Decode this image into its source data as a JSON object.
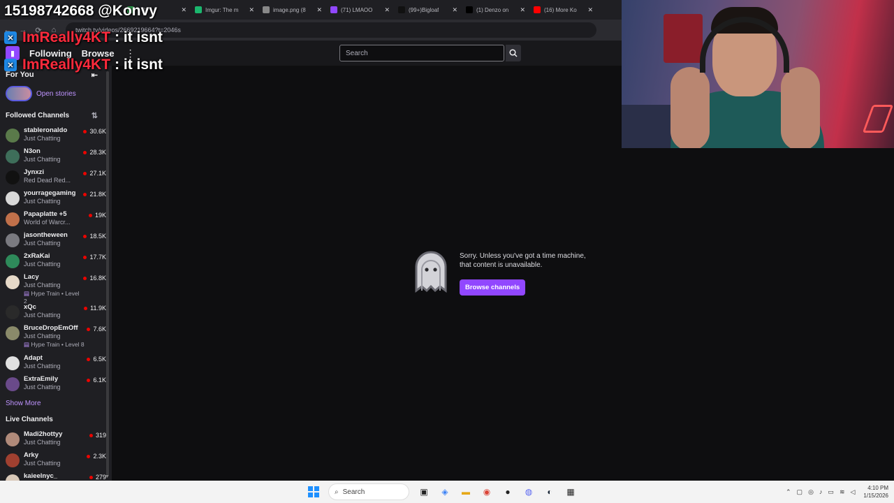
{
  "browser": {
    "tabs": [
      {
        "title": "k Bl",
        "color": "#34a853"
      },
      {
        "title": "Imgur: The m",
        "color": "#1bb76e"
      },
      {
        "title": "image.png (8",
        "color": "#888888"
      },
      {
        "title": "(71) LMAOO",
        "color": "#9147ff"
      },
      {
        "title": "(99+)Bigloaf",
        "color": "#111111"
      },
      {
        "title": "(1) Denzo on",
        "color": "#000000"
      },
      {
        "title": "(16) More Ko",
        "color": "#ff0000"
      }
    ],
    "url": "twitch.tv/videos/2669219664?t=2046s"
  },
  "nav": {
    "following": "Following",
    "browse": "Browse",
    "search_placeholder": "Search"
  },
  "sidebar": {
    "for_you": "For You",
    "open_stories": "Open stories",
    "followed_title": "Followed Channels",
    "followed": [
      {
        "name": "stableronaldo",
        "category": "Just Chatting",
        "viewers": "30.6K",
        "color": "#5a7a4a"
      },
      {
        "name": "N3on",
        "category": "Just Chatting",
        "viewers": "28.3K",
        "color": "#3e6e5a"
      },
      {
        "name": "Jynxzi",
        "category": "Red Dead Red...",
        "viewers": "27.1K",
        "color": "#111111"
      },
      {
        "name": "yourragegaming",
        "category": "Just Chatting",
        "viewers": "21.8K",
        "color": "#d8d8d8"
      },
      {
        "name": "Papaplatte +5",
        "category": "World of Warcr...",
        "viewers": "19K",
        "color": "#c0704a"
      },
      {
        "name": "jasontheween",
        "category": "Just Chatting",
        "viewers": "18.5K",
        "color": "#7a7a80"
      },
      {
        "name": "2xRaKai",
        "category": "Just Chatting",
        "viewers": "17.7K",
        "color": "#2e8a5a"
      },
      {
        "name": "Lacy",
        "category": "Just Chatting",
        "viewers": "16.8K",
        "color": "#e6d9c8",
        "extra": "Hype Train • Level 2"
      },
      {
        "name": "xQc",
        "category": "Just Chatting",
        "viewers": "11.9K",
        "color": "#2a2a2a"
      },
      {
        "name": "BruceDropEmOff",
        "category": "Just Chatting",
        "viewers": "7.6K",
        "color": "#8a8a6a",
        "extra": "Hype Train • Level 8"
      },
      {
        "name": "Adapt",
        "category": "Just Chatting",
        "viewers": "6.5K",
        "color": "#e0e0e0"
      },
      {
        "name": "ExtraEmily",
        "category": "Just Chatting",
        "viewers": "6.1K",
        "color": "#6a4a8a"
      }
    ],
    "show_more": "Show More",
    "live_title": "Live Channels",
    "live": [
      {
        "name": "Madi2hottyy",
        "category": "Just Chatting",
        "viewers": "319",
        "color": "#b08a7a"
      },
      {
        "name": "Arky",
        "category": "Just Chatting",
        "viewers": "2.3K",
        "color": "#a04030"
      },
      {
        "name": "kaieelnyc_",
        "category": "Just Chatting",
        "viewers": "279",
        "color": "#d8c8b8"
      }
    ]
  },
  "error": {
    "line1": "Sorry. Unless you've got a time machine,",
    "line2": "that content is unavailable.",
    "button": "Browse channels"
  },
  "overlay": {
    "phone": "15198742668 @Konvy",
    "user": "ImReally4KT",
    "message": ": it isnt"
  },
  "taskbar": {
    "search": "Search",
    "time": "4:10 PM",
    "date": "1/15/2026"
  }
}
